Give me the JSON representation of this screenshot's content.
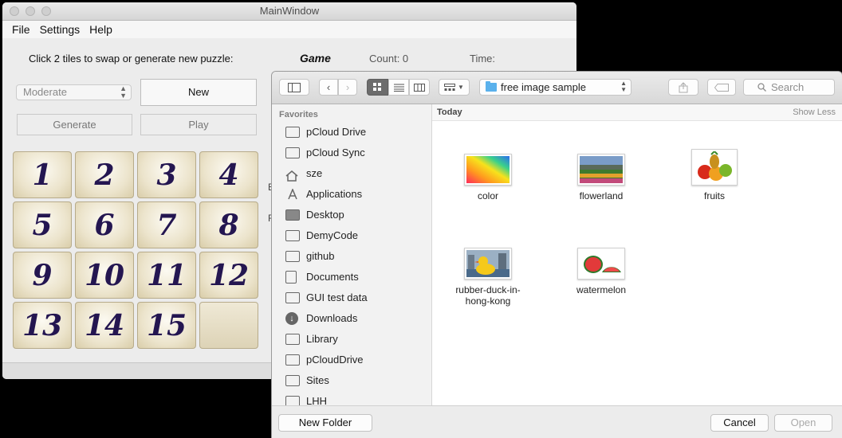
{
  "main_window": {
    "title": "MainWindow",
    "menu": [
      "File",
      "Settings",
      "Help"
    ],
    "instruction": "Click 2 tiles to swap or generate new puzzle:",
    "game_title": "Game",
    "count_label": "Count: 0",
    "time_label": "Time:",
    "difficulty": "Moderate",
    "buttons": {
      "new": "New",
      "generate": "Generate",
      "play": "Play"
    },
    "tiles": [
      "1",
      "2",
      "3",
      "4",
      "5",
      "6",
      "7",
      "8",
      "9",
      "10",
      "11",
      "12",
      "13",
      "14",
      "15",
      ""
    ],
    "partial_labels": [
      "E",
      "F"
    ]
  },
  "dialog": {
    "path_folder": "free image sample",
    "search_placeholder": "Search",
    "favorites_header": "Favorites",
    "sidebar_items": [
      {
        "label": "pCloud Drive",
        "icon": "drive-icon"
      },
      {
        "label": "pCloud Sync",
        "icon": "folder-icon"
      },
      {
        "label": "sze",
        "icon": "home-icon"
      },
      {
        "label": "Applications",
        "icon": "applications-icon"
      },
      {
        "label": "Desktop",
        "icon": "desktop-icon"
      },
      {
        "label": "DemyCode",
        "icon": "folder-icon"
      },
      {
        "label": "github",
        "icon": "folder-icon"
      },
      {
        "label": "Documents",
        "icon": "documents-icon"
      },
      {
        "label": "GUI test data",
        "icon": "folder-icon"
      },
      {
        "label": "Downloads",
        "icon": "downloads-icon"
      },
      {
        "label": "Library",
        "icon": "folder-icon"
      },
      {
        "label": "pCloudDrive",
        "icon": "folder-icon"
      },
      {
        "label": "Sites",
        "icon": "folder-icon"
      },
      {
        "label": "LHH",
        "icon": "folder-icon"
      }
    ],
    "section_title": "Today",
    "show_less": "Show Less",
    "files": [
      {
        "name": "color"
      },
      {
        "name": "flowerland"
      },
      {
        "name": "fruits"
      },
      {
        "name": "rubber-duck-in-hong-kong"
      },
      {
        "name": "watermelon"
      }
    ],
    "buttons": {
      "new_folder": "New Folder",
      "cancel": "Cancel",
      "open": "Open"
    }
  },
  "colors": {
    "tile_text": "#241651",
    "folder_blue": "#5ab1ec",
    "selected_view": "#6c6c6c"
  }
}
